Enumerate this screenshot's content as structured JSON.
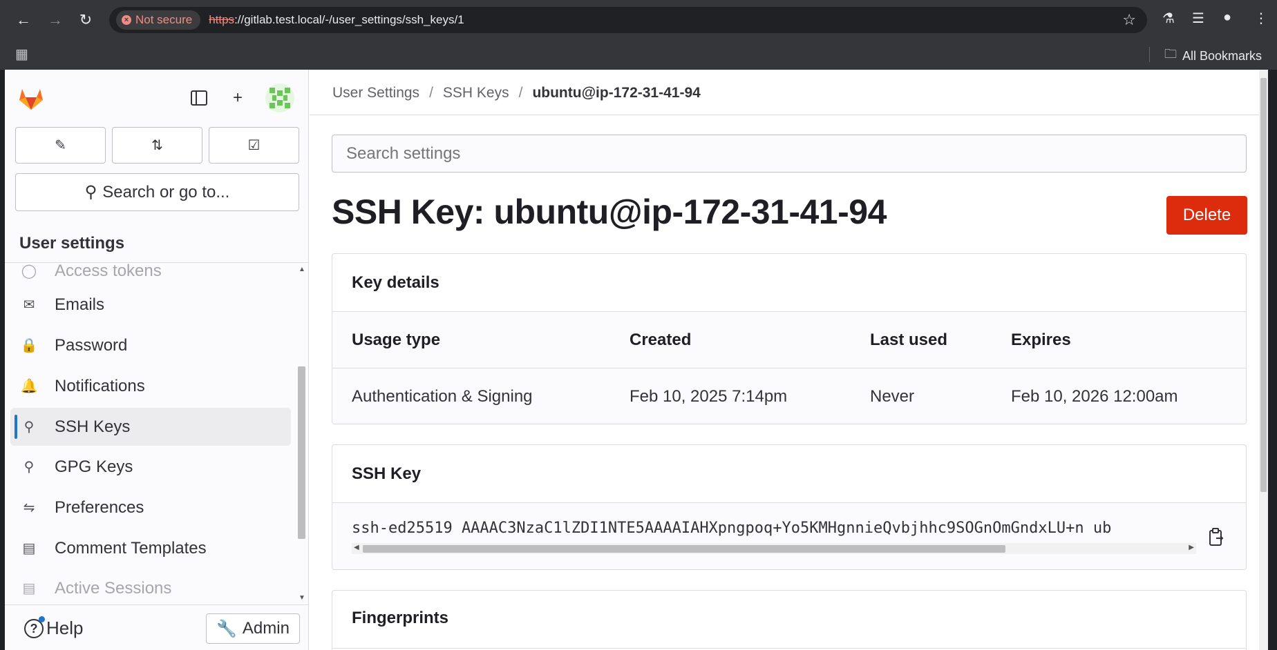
{
  "browser": {
    "security_label": "Not secure",
    "url_scheme": "https",
    "url_rest": "://gitlab.test.local/-/user_settings/ssh_keys/1",
    "bookmarks_label": "All Bookmarks"
  },
  "sidebar": {
    "search_label": "Search or go to...",
    "section_title": "User settings",
    "items": [
      {
        "label": "Access tokens",
        "icon": "token-icon"
      },
      {
        "label": "Emails",
        "icon": "mail-icon"
      },
      {
        "label": "Password",
        "icon": "lock-icon"
      },
      {
        "label": "Notifications",
        "icon": "bell-icon"
      },
      {
        "label": "SSH Keys",
        "icon": "key-icon"
      },
      {
        "label": "GPG Keys",
        "icon": "key-icon"
      },
      {
        "label": "Preferences",
        "icon": "preferences-icon"
      },
      {
        "label": "Comment Templates",
        "icon": "comment-icon"
      },
      {
        "label": "Active Sessions",
        "icon": "sessions-icon"
      }
    ],
    "active_item": "SSH Keys",
    "help_label": "Help",
    "admin_label": "Admin"
  },
  "breadcrumb": {
    "items": [
      "User Settings",
      "SSH Keys"
    ],
    "current": "ubuntu@ip-172-31-41-94"
  },
  "search_settings": {
    "placeholder": "Search settings"
  },
  "title": "SSH Key: ubuntu@ip-172-31-41-94",
  "delete_label": "Delete",
  "key_details": {
    "heading": "Key details",
    "columns": [
      "Usage type",
      "Created",
      "Last used",
      "Expires"
    ],
    "values": [
      "Authentication & Signing",
      "Feb 10, 2025 7:14pm",
      "Never",
      "Feb 10, 2026 12:00am"
    ]
  },
  "ssh_key": {
    "heading": "SSH Key",
    "value": "ssh-ed25519 AAAAC3NzaC1lZDI1NTE5AAAAIAHXpngpoq+Yo5KMHgnnieQvbjhhc9SOGnOmGndxLU+n ub"
  },
  "fingerprints": {
    "heading": "Fingerprints"
  },
  "colors": {
    "danger": "#dd2b0e",
    "active_indicator": "#1f75cb"
  }
}
